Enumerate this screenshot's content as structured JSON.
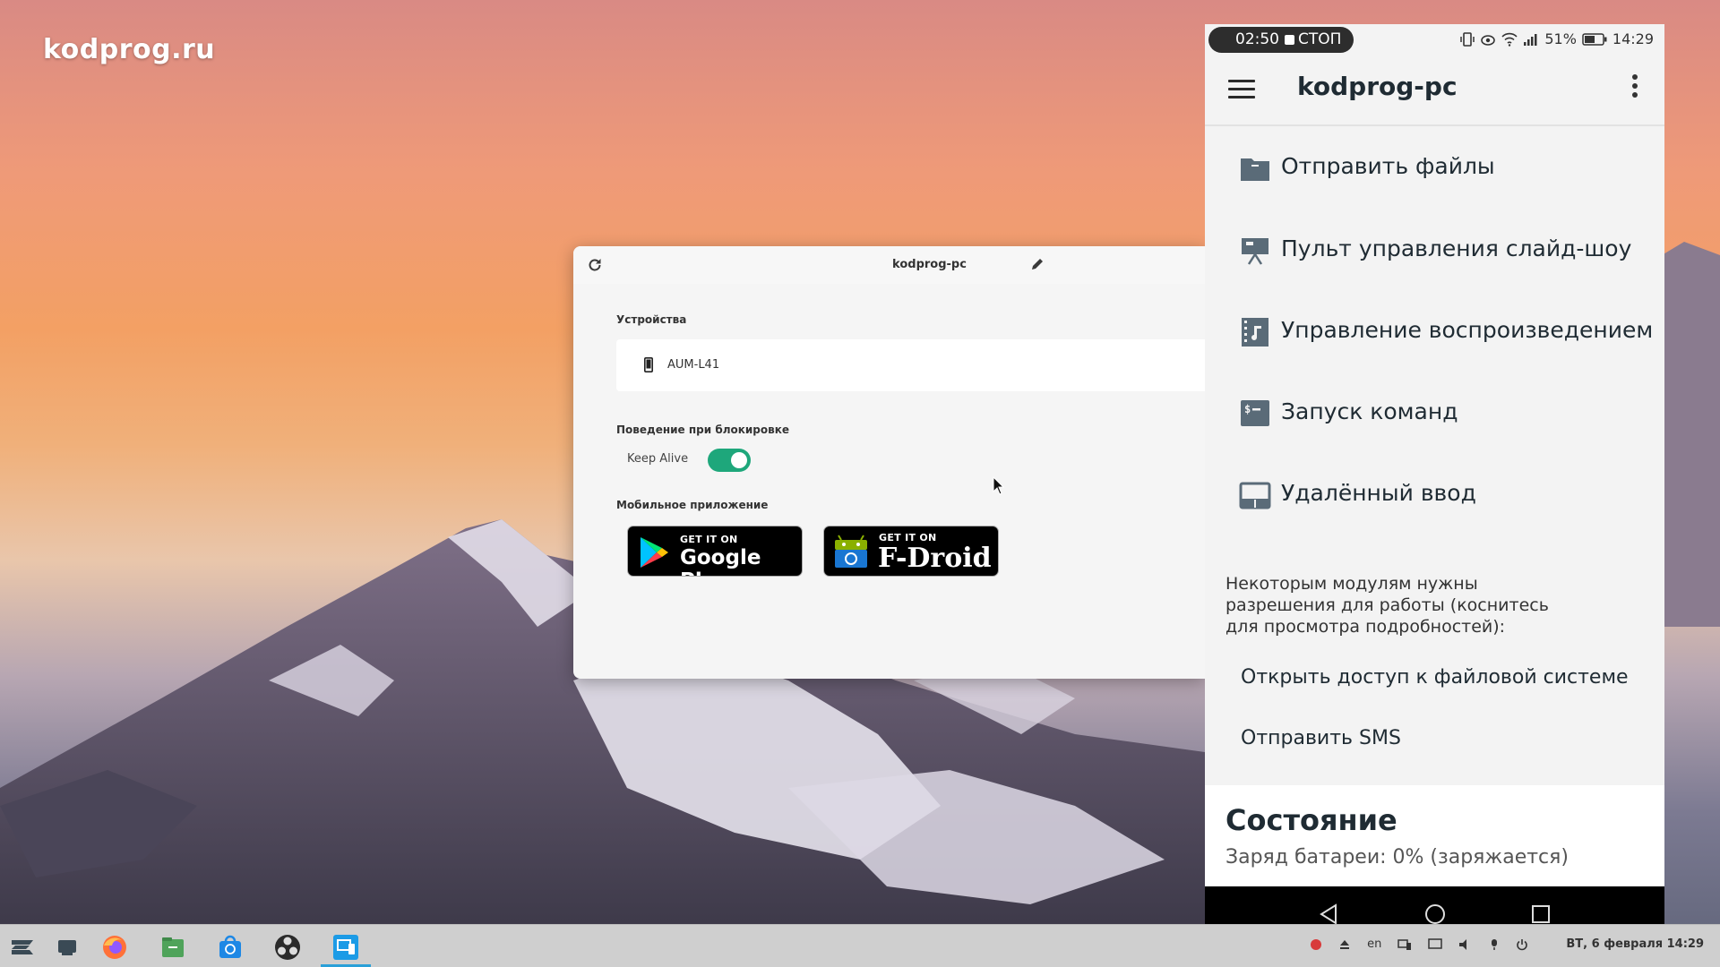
{
  "watermark": "kodprog.ru",
  "desktop_window": {
    "title": "kodprog-pc",
    "refresh_icon": "refresh-icon",
    "edit_icon": "pencil-icon",
    "devices_label": "Устройства",
    "device_name": "AUM-L41",
    "lock_behavior_label": "Поведение при блокировке",
    "keep_alive_label": "Keep Alive",
    "keep_alive_on": true,
    "mobile_app_label": "Мобильное приложение",
    "google_play_small": "GET IT ON",
    "google_play_big": "Google Play",
    "fdroid_small": "GET IT ON",
    "fdroid_big": "F-Droid",
    "accent_color": "#1ea77b"
  },
  "phone": {
    "recording_time": "02:50",
    "recording_stop": "СТОП",
    "battery_percent": "51%",
    "clock": "14:29",
    "app_title": "kodprog-pc",
    "plugins": [
      {
        "label": "Отправить файлы",
        "icon": "folder-icon"
      },
      {
        "label": "Пульт управления слайд-шоу",
        "icon": "presentation-icon"
      },
      {
        "label": "Управление воспроизведением",
        "icon": "media-film-icon"
      },
      {
        "label": "Запуск команд",
        "icon": "terminal-icon"
      },
      {
        "label": "Удалённый ввод",
        "icon": "touchpad-icon"
      }
    ],
    "permissions_note": "Некоторым модулям нужны разрешения для работы (коснитесь для просмотра подробностей):",
    "permission_links": [
      "Открыть доступ к файловой системе",
      "Отправить SMS"
    ],
    "status_title": "Состояние",
    "battery_status": "Заряд батареи: 0% (заряжается)"
  },
  "taskbar": {
    "apps": [
      "zorin-menu-icon",
      "show-desktop-icon",
      "firefox-icon",
      "files-icon",
      "software-store-icon",
      "obs-icon",
      "kdeconnect-icon"
    ],
    "tray": {
      "keyboard_layout": "en",
      "datetime": "ВТ, 6 февраля 14:29"
    }
  }
}
